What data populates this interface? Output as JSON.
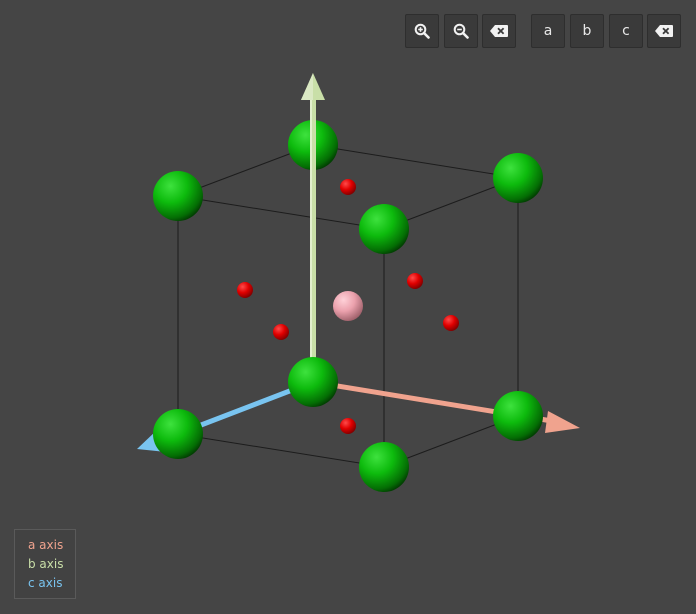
{
  "toolbar": {
    "zoom_in_icon": "zoom-in-icon",
    "zoom_out_icon": "zoom-out-icon",
    "clear_icon": "backspace-icon",
    "view_a_label": "a",
    "view_b_label": "b",
    "view_c_label": "c",
    "clear_view_icon": "backspace-icon"
  },
  "legend": {
    "a_axis": "a axis",
    "b_axis": "b axis",
    "c_axis": "c axis"
  },
  "colors": {
    "background": "#454545",
    "a_axis": "#f0a38e",
    "b_axis": "#c9dfa8",
    "c_axis": "#79c4f0",
    "large_atom": "#0fb30f",
    "small_atom": "#e00000",
    "center_atom": "#f2a6b3"
  }
}
